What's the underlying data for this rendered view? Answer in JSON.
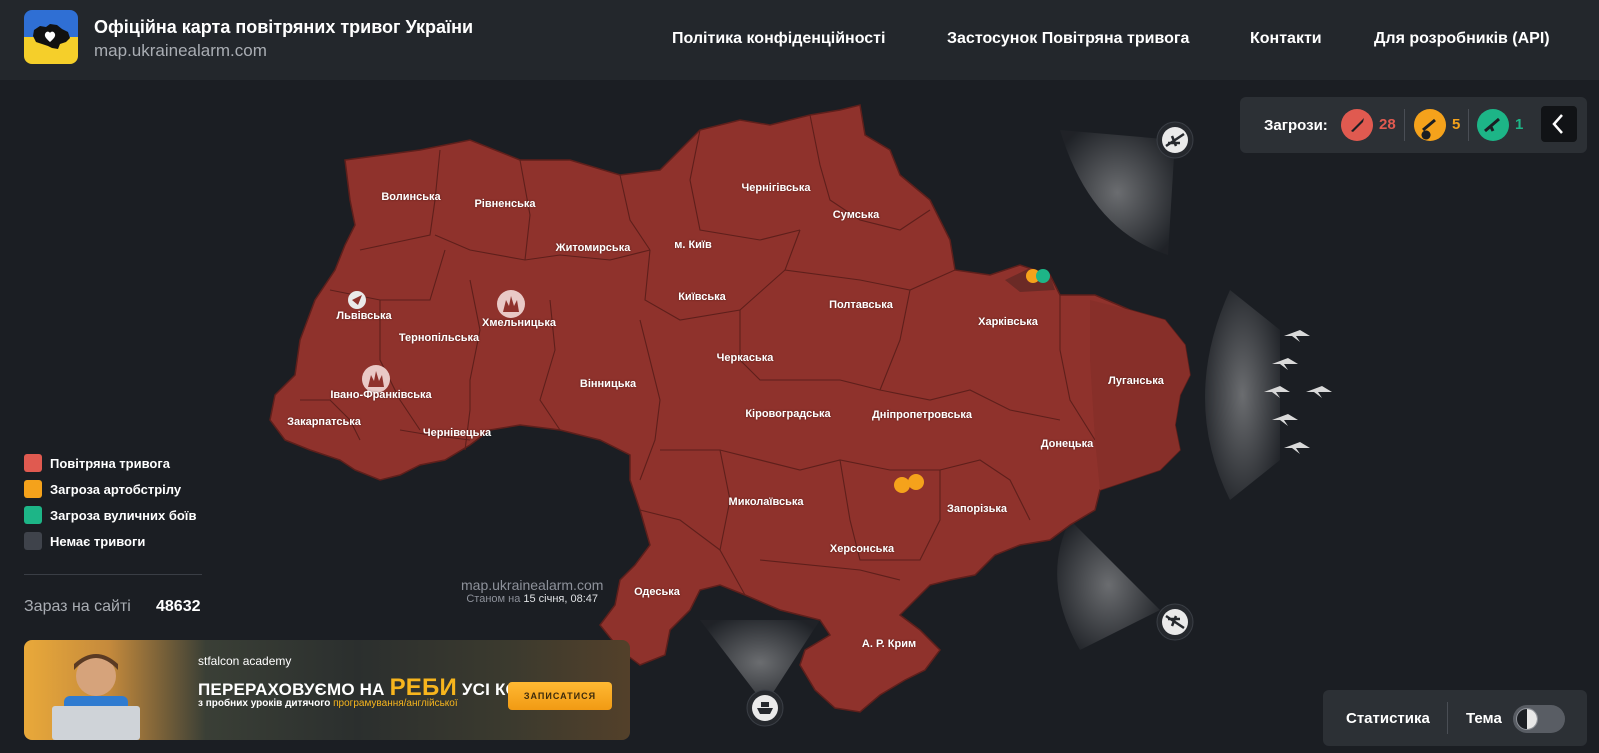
{
  "header": {
    "title": "Офіційна карта повітряних тривог України",
    "url": "map.ukrainealarm.com",
    "nav": [
      {
        "label": "Політика конфіденційності"
      },
      {
        "label": "Застосунок Повітряна тривога"
      },
      {
        "label": "Контакти"
      },
      {
        "label": "Для розробників (API)"
      }
    ]
  },
  "threats": {
    "label": "Загрози:",
    "items": [
      {
        "icon": "missile-icon",
        "count": "28",
        "color": "#e05a50"
      },
      {
        "icon": "artillery-icon",
        "count": "5",
        "color": "#f5a21b"
      },
      {
        "icon": "rifle-icon",
        "count": "1",
        "color": "#1db587"
      }
    ]
  },
  "map": {
    "region_color": "#8f322c",
    "regions": [
      "Волинська",
      "Рівненська",
      "Житомирська",
      "м. Київ",
      "Чернігівська",
      "Сумська",
      "Львівська",
      "Хмельницька",
      "Тернопільська",
      "Київська",
      "Полтавська",
      "Харківська",
      "Луганська",
      "Івано-Франківська",
      "Вінницька",
      "Черкаська",
      "Закарпатська",
      "Кіровоградська",
      "Дніпропетровська",
      "Чернівецька",
      "Донецька",
      "Миколаївська",
      "Запорізька",
      "Херсонська",
      "Одеська",
      "А. Р. Крим"
    ],
    "watermark": "map.ukrainealarm.com",
    "as_of_prefix": "Станом на",
    "as_of_value": "15 січня, 08:47"
  },
  "legend": [
    {
      "label": "Повітряна тривога",
      "color": "#e05a50"
    },
    {
      "label": "Загроза артобстрілу",
      "color": "#f5a21b"
    },
    {
      "label": "Загроза вуличних боїв",
      "color": "#1db587"
    },
    {
      "label": "Немає тривоги",
      "color": "#3f434b"
    }
  ],
  "online": {
    "label": "Зараз на сайті",
    "value": "48632"
  },
  "ad": {
    "brand": "stfalcon academy",
    "headline_a": "ПЕРЕРАХОВУЄМО НА",
    "headline_b": "РЕБИ",
    "headline_c": "УСІ КОШТИ",
    "sub_a": "з пробних уроків дитячого",
    "sub_b": "програмування/англійської",
    "cta": "ЗАПИСАТИСЯ"
  },
  "bottom": {
    "stats": "Статистика",
    "theme": "Тема"
  }
}
